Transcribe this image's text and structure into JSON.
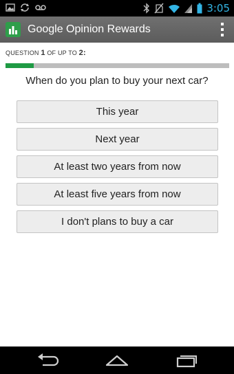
{
  "status_bar": {
    "time": "3:05",
    "left_icons": [
      "gallery-icon",
      "sync-icon",
      "voicemail-icon"
    ],
    "right_icons": [
      "bluetooth-icon",
      "no-sim-icon",
      "wifi-icon",
      "signal-icon",
      "battery-icon"
    ]
  },
  "action_bar": {
    "title": "Google Opinion Rewards",
    "app_icon": "opinion-rewards-icon",
    "overflow_icon": "overflow-menu-icon",
    "bar_color": "#666666",
    "icon_color": "#2e9e4a"
  },
  "survey": {
    "counter_prefix": "QUESTION ",
    "counter_current": "1",
    "counter_middle": " OF UP TO ",
    "counter_total": "2",
    "counter_suffix": ":",
    "progress_fraction": 0.125,
    "progress_color": "#1f9a44",
    "question": "When do you plan to buy your next car?",
    "answers": [
      "This year",
      "Next year",
      "At least two years from now",
      "At least five years from now",
      "I don't plans to buy a car"
    ]
  },
  "nav_bar": {
    "icons": [
      "back-icon",
      "home-icon",
      "recent-apps-icon"
    ]
  }
}
